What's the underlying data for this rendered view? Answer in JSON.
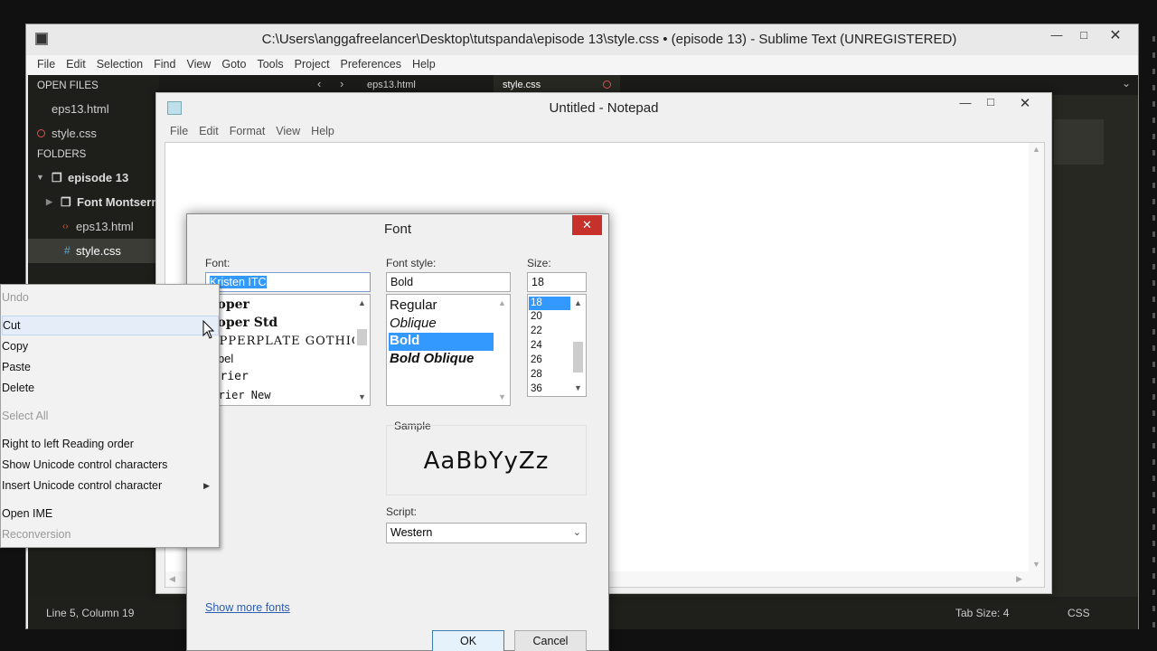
{
  "sublime": {
    "title": "C:\\Users\\anggafreelancer\\Desktop\\tutspanda\\episode 13\\style.css • (episode 13) - Sublime Text (UNREGISTERED)",
    "menu": [
      "File",
      "Edit",
      "Selection",
      "Find",
      "View",
      "Goto",
      "Tools",
      "Project",
      "Preferences",
      "Help"
    ],
    "sidebar": {
      "open_files_heading": "OPEN FILES",
      "open_files": [
        "eps13.html",
        "style.css"
      ],
      "folders_heading": "FOLDERS",
      "folder_name": "episode 13",
      "subfolder_name": "Font Montserrat",
      "files": [
        "eps13.html",
        "style.css"
      ]
    },
    "tabs": [
      "eps13.html",
      "style.css"
    ],
    "status": {
      "position": "Line 5, Column 19",
      "tab_size": "Tab Size: 4",
      "syntax": "CSS"
    }
  },
  "notepad": {
    "title": "Untitled - Notepad",
    "menu": [
      "File",
      "Edit",
      "Format",
      "View",
      "Help"
    ]
  },
  "font_dialog": {
    "title": "Font",
    "font_label": "Font:",
    "font_value": "Kristen ITC",
    "font_list": [
      "Cooper",
      "Cooper Std",
      "COPPERPLATE GOTHIC",
      "Corbel",
      "Courier",
      "Courier New"
    ],
    "style_label": "Font style:",
    "style_value": "Bold",
    "style_list": [
      "Regular",
      "Oblique",
      "Bold",
      "Bold Oblique"
    ],
    "style_selected": "Bold",
    "size_label": "Size:",
    "size_value": "18",
    "size_list": [
      "18",
      "20",
      "22",
      "24",
      "26",
      "28",
      "36"
    ],
    "sample_label": "Sample",
    "sample_text": "AaBbYyZz",
    "script_label": "Script:",
    "script_value": "Western",
    "show_more_fonts": "Show more fonts",
    "ok": "OK",
    "cancel": "Cancel"
  },
  "context_menu": {
    "undo": "Undo",
    "cut": "Cut",
    "copy": "Copy",
    "paste": "Paste",
    "delete": "Delete",
    "select_all": "Select All",
    "rtl": "Right to left Reading order",
    "show_unicode": "Show Unicode control characters",
    "insert_unicode": "Insert Unicode control character",
    "open_ime": "Open IME",
    "reconversion": "Reconversion"
  },
  "colors": {
    "sublime_bg": "#272822",
    "selection": "#3399ff",
    "close_red": "#c7302b",
    "link": "#2a5db0"
  }
}
